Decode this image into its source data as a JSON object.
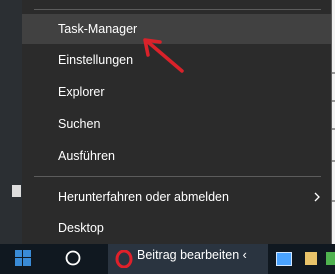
{
  "menu": {
    "items": [
      {
        "label": "Task-Manager"
      },
      {
        "label": "Einstellungen"
      },
      {
        "label": "Explorer"
      },
      {
        "label": "Suchen"
      },
      {
        "label": "Ausführen"
      },
      {
        "label": "Herunterfahren oder abmelden"
      },
      {
        "label": "Desktop"
      }
    ]
  },
  "taskbar": {
    "window_title": "Beitrag bearbeiten ‹"
  },
  "colors": {
    "menu_bg": "#2b2b2b",
    "hover_bg": "#414141",
    "arrow": "#d9222a",
    "taskbar_bg": "#101820"
  },
  "icons": [
    "chevron-right-icon",
    "windows-start-icon",
    "search-circle-icon",
    "opera-icon",
    "app-icon"
  ]
}
